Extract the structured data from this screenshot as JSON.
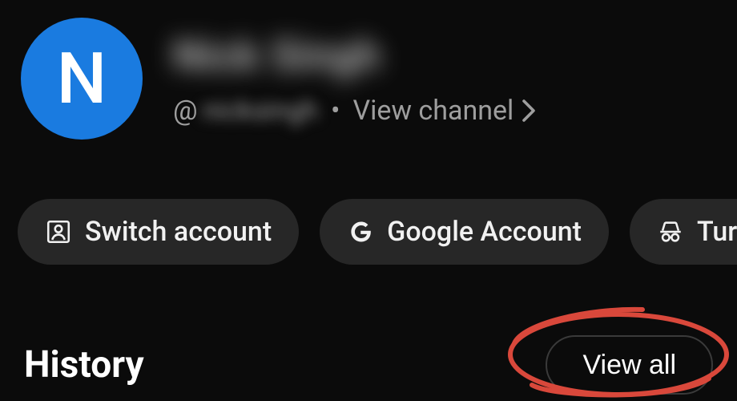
{
  "profile": {
    "avatar_letter": "N",
    "avatar_bg": "#1a7be0",
    "display_name": "Nick Singh",
    "handle_prefix": "@",
    "handle": "nicksingh",
    "separator": "•",
    "view_channel_label": "View channel"
  },
  "chips": {
    "switch_account": "Switch account",
    "google_account": "Google Account",
    "incognito": "Turn"
  },
  "sections": {
    "history_title": "History",
    "view_all_label": "View all"
  },
  "colors": {
    "chip_bg": "#272727",
    "text_muted": "#9e9e9e",
    "annotation_red": "#d9483b"
  }
}
